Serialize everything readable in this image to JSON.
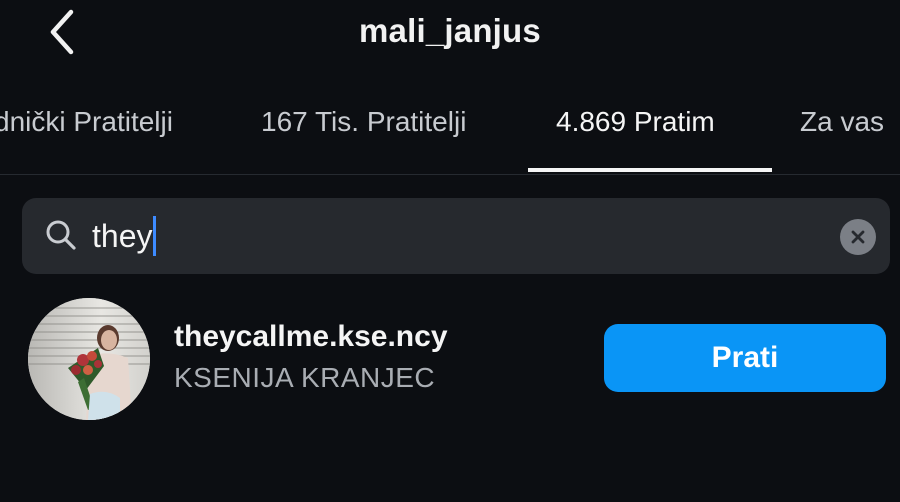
{
  "header": {
    "title": "mali_janjus",
    "back_icon": "chevron-left-icon"
  },
  "tabs": [
    {
      "label": "dnički Pratitelji",
      "active": false
    },
    {
      "label": "167 Tis. Pratitelji",
      "active": false
    },
    {
      "label": "4.869 Pratim",
      "active": true
    },
    {
      "label": "Za vas",
      "active": false
    }
  ],
  "search": {
    "value": "they",
    "icon": "search-icon",
    "clear_icon": "clear-icon"
  },
  "results": [
    {
      "username": "theycallme.kse.ncy",
      "full_name": "KSENIJA KRANJEC",
      "button_label": "Prati"
    }
  ],
  "colors": {
    "background": "#0c0e12",
    "accent": "#0a95f6",
    "search_bg": "#26292e",
    "secondary_text": "#a9adb3"
  }
}
